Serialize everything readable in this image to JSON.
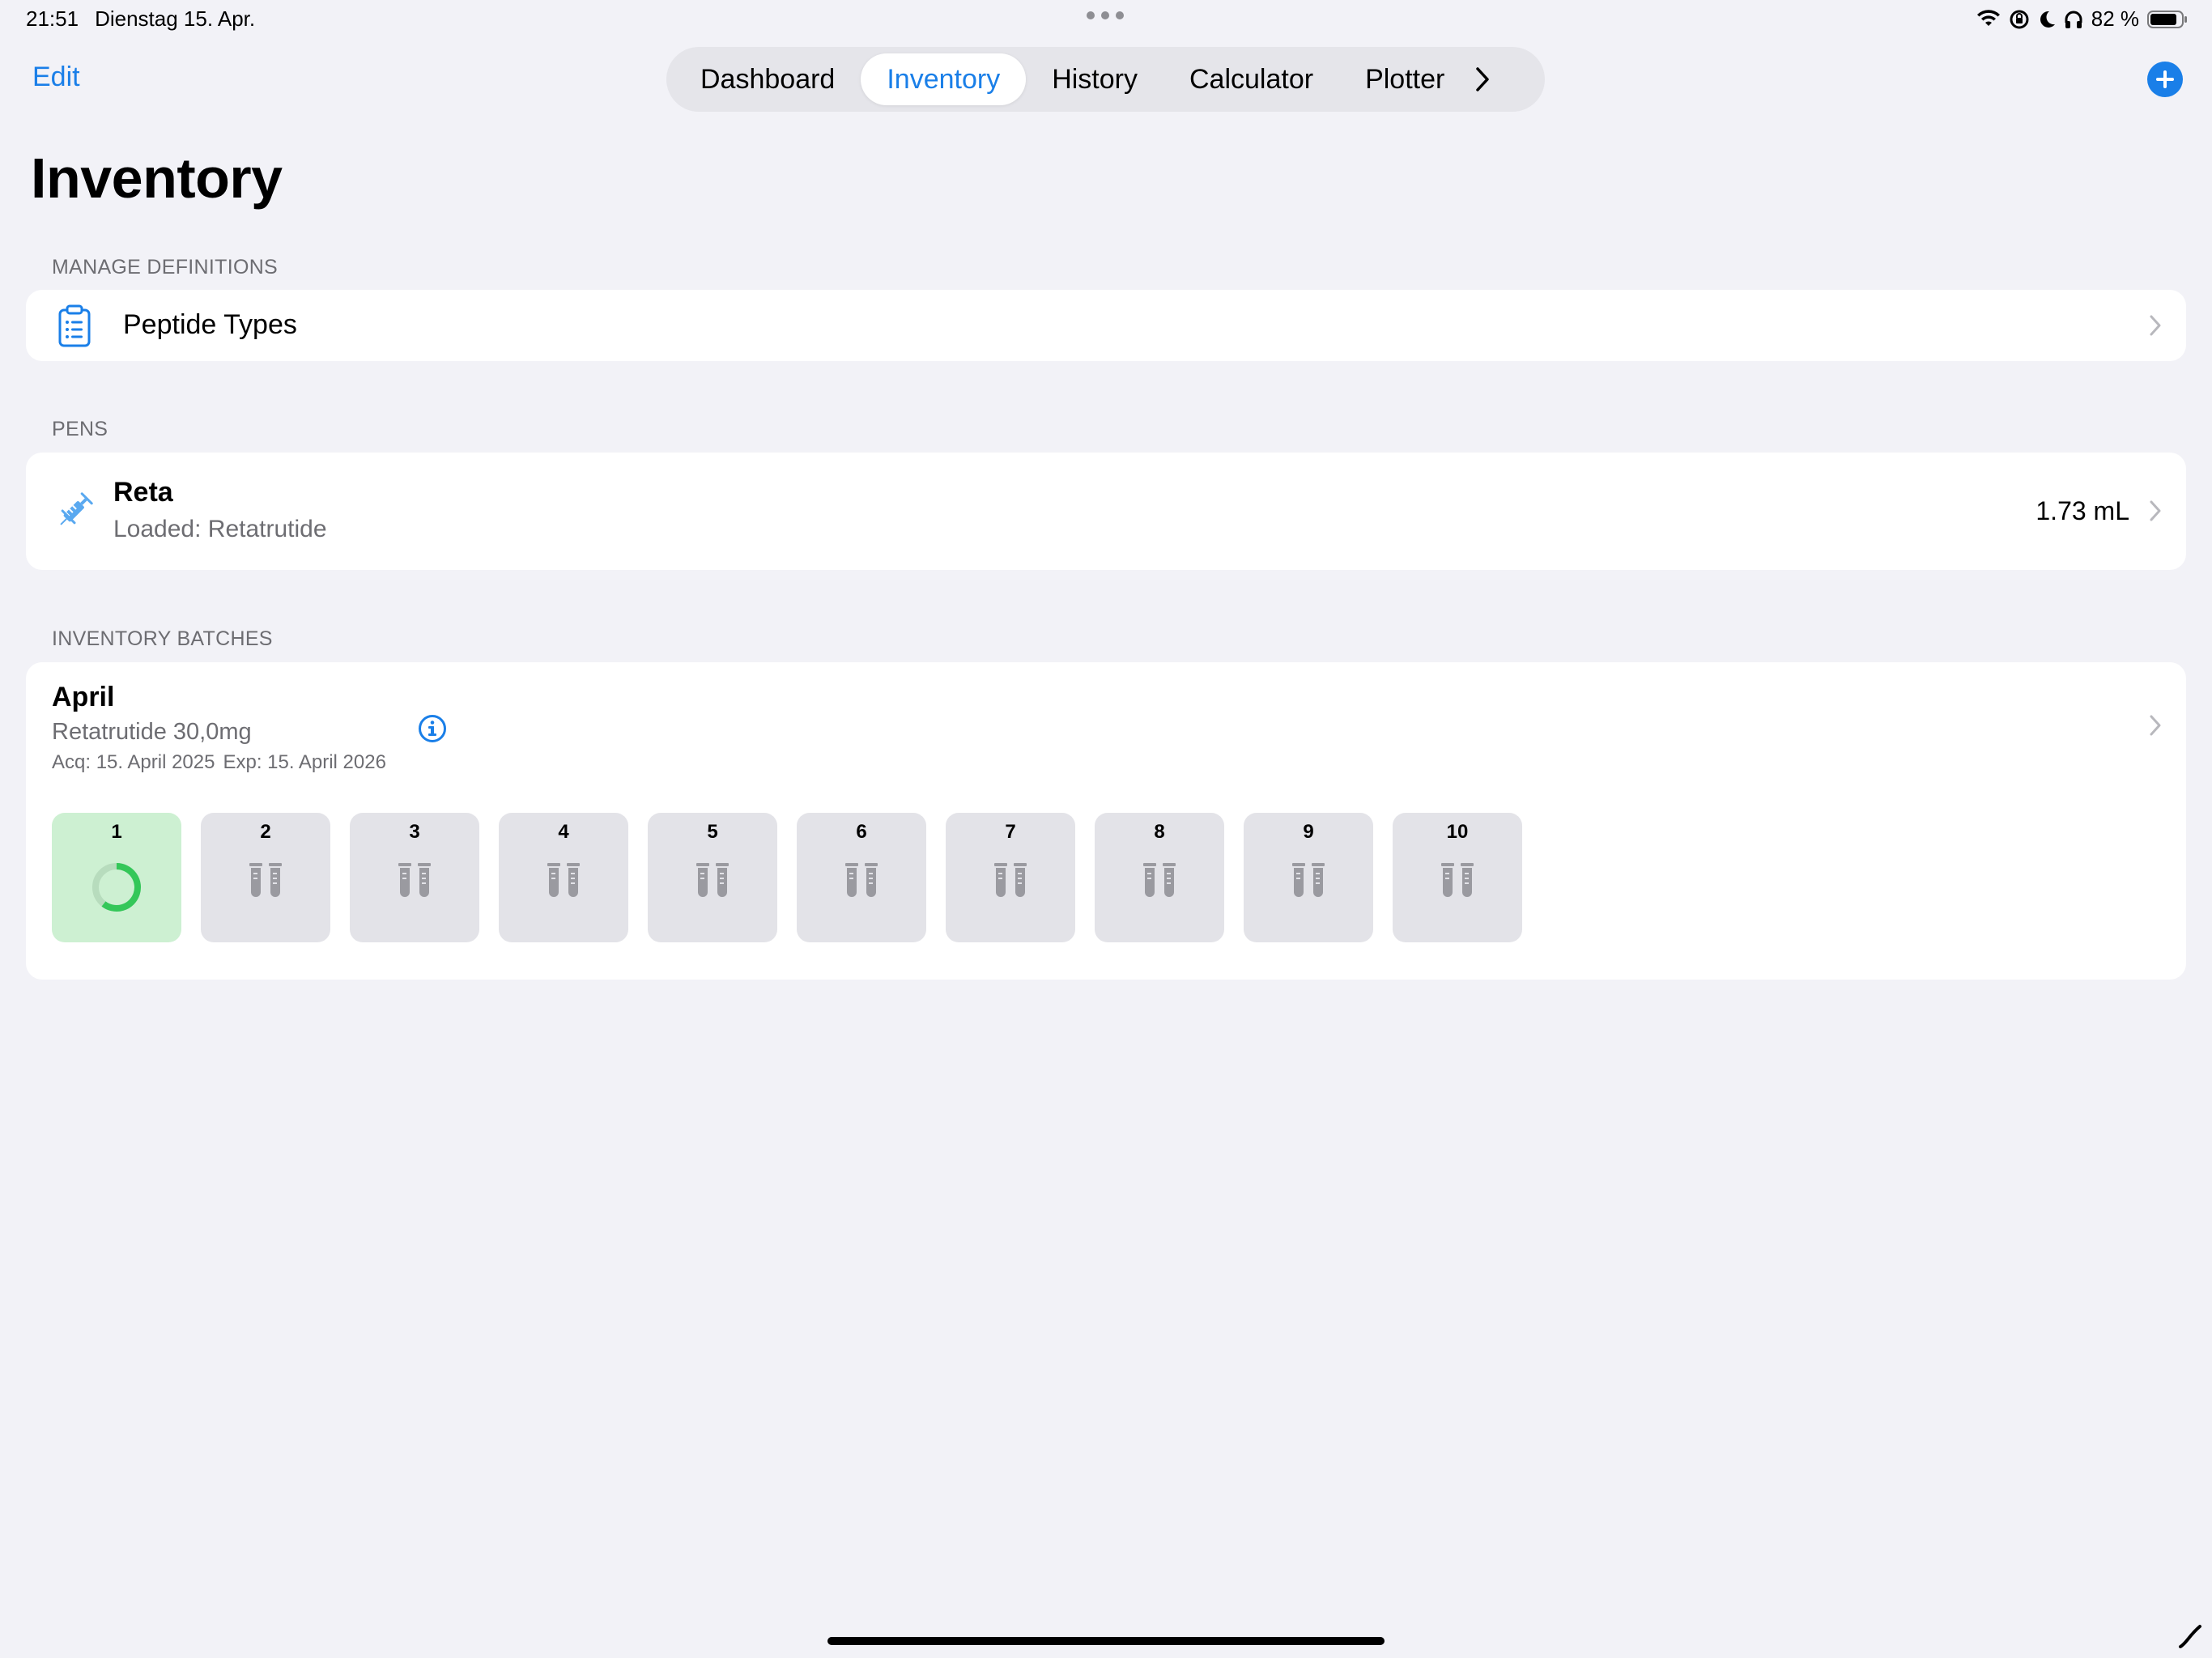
{
  "status": {
    "time": "21:51",
    "date": "Dienstag 15. Apr.",
    "battery": "82 %"
  },
  "nav": {
    "edit_label": "Edit",
    "tabs": [
      {
        "label": "Dashboard"
      },
      {
        "label": "Inventory"
      },
      {
        "label": "History"
      },
      {
        "label": "Calculator"
      },
      {
        "label": "Plotter"
      }
    ],
    "active_tab": "Inventory"
  },
  "page": {
    "title": "Inventory"
  },
  "definitions": {
    "header": "MANAGE DEFINITIONS",
    "peptide_types_label": "Peptide Types"
  },
  "pens": {
    "header": "PENS",
    "items": [
      {
        "name": "Reta",
        "loaded": "Loaded: Retatrutide",
        "volume": "1.73 mL"
      }
    ]
  },
  "batches": {
    "header": "INVENTORY BATCHES",
    "items": [
      {
        "name": "April",
        "peptide": "Retatrutide 30,0mg",
        "acq": "Acq: 15. April 2025",
        "exp": "Exp: 15. April 2026",
        "vials": [
          "1",
          "2",
          "3",
          "4",
          "5",
          "6",
          "7",
          "8",
          "9",
          "10"
        ],
        "active_vial": "1"
      }
    ]
  },
  "colors": {
    "accent": "#1a7fe8",
    "active_vial_bg": "#cdf0d2",
    "progress_green": "#34c759"
  }
}
